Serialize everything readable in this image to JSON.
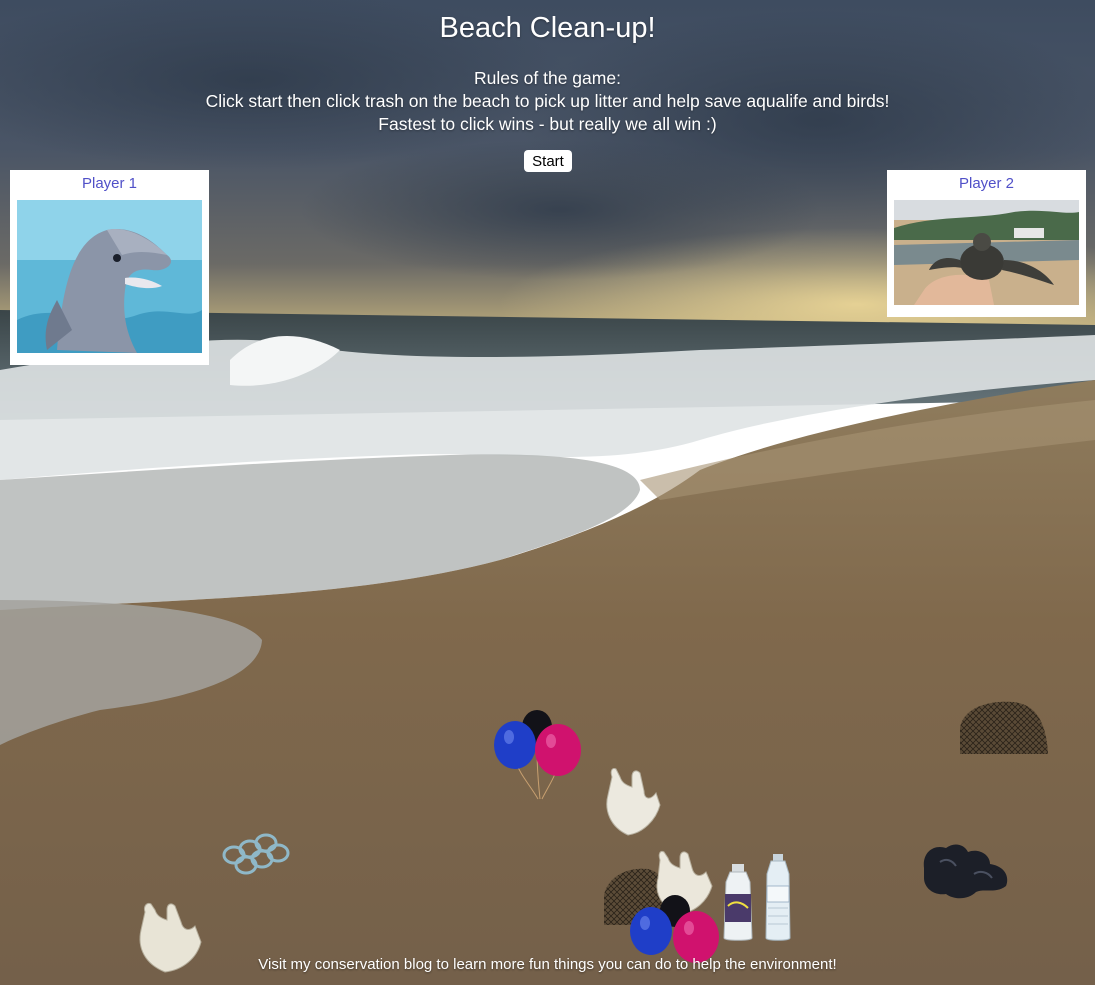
{
  "game": {
    "title": "Beach Clean-up!",
    "rules_heading": "Rules of the game:",
    "rules_line1": "Click start then click trash on the beach to pick up litter and help save aqualife and birds!",
    "rules_line2": "Fastest to click wins - but really we all win :)",
    "start_label": "Start"
  },
  "players": {
    "player1": {
      "name": "Player 1",
      "avatar": "dolphin"
    },
    "player2": {
      "name": "Player 2",
      "avatar": "sea-turtle"
    }
  },
  "trash_items": [
    "balloons",
    "plastic-bag",
    "fishing-net",
    "six-pack-rings",
    "plastic-bag",
    "fishing-net",
    "plastic-bag",
    "water-bottle",
    "water-bottle",
    "garbage-bag",
    "balloons",
    "plastic-bag"
  ],
  "footer": {
    "text": "Visit my conservation blog to learn more fun things you can do to help the environment!"
  },
  "colors": {
    "player_label": "#5050c8",
    "sky": "#3b4a5c",
    "sand": "#8a7558",
    "sea": "#5a6a74"
  }
}
